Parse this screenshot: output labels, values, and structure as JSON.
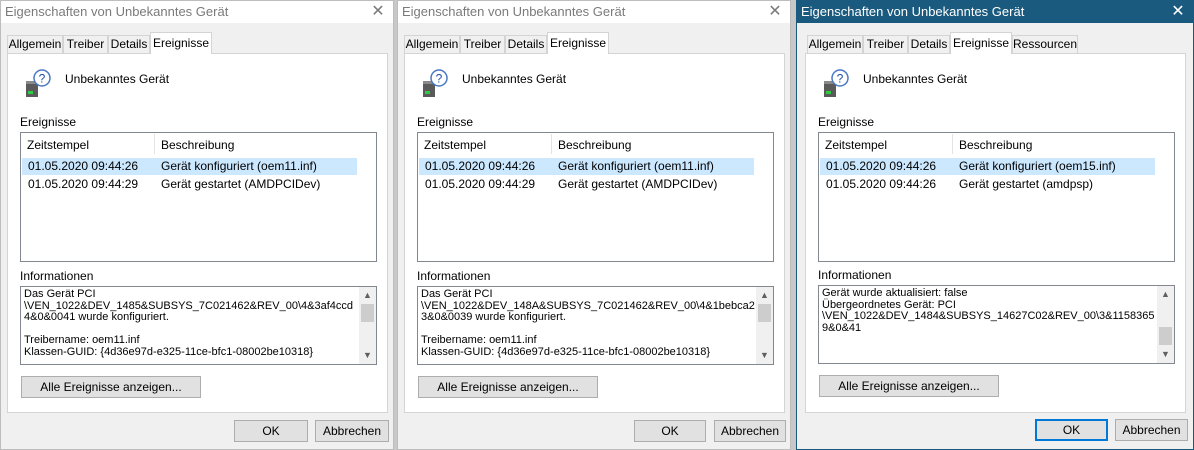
{
  "dialogs": [
    {
      "title": "Eigenschaften von Unbekanntes Gerät",
      "close_glyph": "✕",
      "tabs": [
        "Allgemein",
        "Treiber",
        "Details",
        "Ereignisse"
      ],
      "selected_tab": "Ereignisse",
      "device_name": "Unbekanntes Gerät",
      "events_label": "Ereignisse",
      "columns": [
        "Zeitstempel",
        "Beschreibung"
      ],
      "events": [
        {
          "timestamp": "01.05.2020 09:44:26",
          "description": "Gerät konfiguriert (oem11.inf)"
        },
        {
          "timestamp": "01.05.2020 09:44:29",
          "description": "Gerät gestartet (AMDPCIDev)"
        }
      ],
      "info_label": "Informationen",
      "info_text": "Das Gerät PCI\n\\VEN_1022&DEV_1485&SUBSYS_7C021462&REV_00\\4&3af4ccd4&0&0041 wurde konfiguriert.\n\nTreibername: oem11.inf\nKlassen-GUID: {4d36e97d-e325-11ce-bfc1-08002be10318}",
      "all_events_button": "Alle Ereignisse anzeigen...",
      "ok_button": "OK",
      "cancel_button": "Abbrechen"
    },
    {
      "title": "Eigenschaften von Unbekanntes Gerät",
      "close_glyph": "✕",
      "tabs": [
        "Allgemein",
        "Treiber",
        "Details",
        "Ereignisse"
      ],
      "selected_tab": "Ereignisse",
      "device_name": "Unbekanntes Gerät",
      "events_label": "Ereignisse",
      "columns": [
        "Zeitstempel",
        "Beschreibung"
      ],
      "events": [
        {
          "timestamp": "01.05.2020 09:44:26",
          "description": "Gerät konfiguriert (oem11.inf)"
        },
        {
          "timestamp": "01.05.2020 09:44:29",
          "description": "Gerät gestartet (AMDPCIDev)"
        }
      ],
      "info_label": "Informationen",
      "info_text": "Das Gerät PCI\n\\VEN_1022&DEV_148A&SUBSYS_7C021462&REV_00\\4&1bebca23&0&0039 wurde konfiguriert.\n\nTreibername: oem11.inf\nKlassen-GUID: {4d36e97d-e325-11ce-bfc1-08002be10318}",
      "all_events_button": "Alle Ereignisse anzeigen...",
      "ok_button": "OK",
      "cancel_button": "Abbrechen"
    },
    {
      "title": "Eigenschaften von Unbekanntes Gerät",
      "close_glyph": "✕",
      "tabs": [
        "Allgemein",
        "Treiber",
        "Details",
        "Ereignisse",
        "Ressourcen"
      ],
      "selected_tab": "Ereignisse",
      "device_name": "Unbekanntes Gerät",
      "events_label": "Ereignisse",
      "columns": [
        "Zeitstempel",
        "Beschreibung"
      ],
      "events": [
        {
          "timestamp": "01.05.2020 09:44:26",
          "description": "Gerät konfiguriert (oem15.inf)"
        },
        {
          "timestamp": "01.05.2020 09:44:26",
          "description": "Gerät gestartet (amdpsp)"
        }
      ],
      "info_label": "Informationen",
      "info_text": "Gerät wurde aktualisiert: false\nÜbergeordnetes Gerät: PCI\n\\VEN_1022&DEV_1484&SUBSYS_14627C02&REV_00\\3&11583659&0&41",
      "all_events_button": "Alle Ereignisse anzeigen...",
      "ok_button": "OK",
      "cancel_button": "Abbrechen"
    }
  ],
  "colors": {
    "active_titlebar": "#1a5a7e",
    "selection": "#cce8ff",
    "dialog_bg": "#f0f0f0",
    "default_button_border": "#0078d7"
  },
  "icons": {
    "device": "unknown-device-question-icon",
    "close": "close-icon",
    "scroll_up": "scroll-up-arrow-icon",
    "scroll_down": "scroll-down-arrow-icon"
  }
}
